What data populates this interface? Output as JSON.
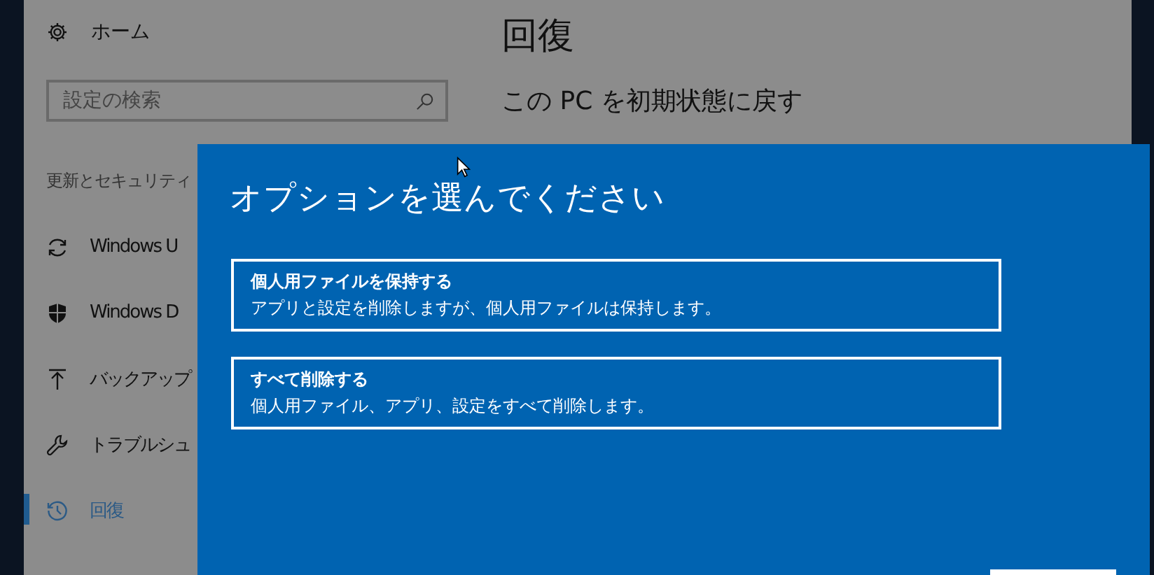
{
  "sidebar": {
    "home": "ホーム",
    "search": {
      "placeholder": "設定の検索"
    },
    "section": "更新とセキュリティ",
    "items": [
      {
        "kind": "sync",
        "label": "Windows U",
        "selected": false
      },
      {
        "kind": "shield",
        "label": "Windows D",
        "selected": false
      },
      {
        "kind": "backup",
        "label": "バックアップ",
        "selected": false
      },
      {
        "kind": "wrench",
        "label": "トラブルシュ",
        "selected": false
      },
      {
        "kind": "history",
        "label": "回復",
        "selected": true
      }
    ]
  },
  "content": {
    "title": "回復",
    "heading": "この PC を初期状態に戻す"
  },
  "dialog": {
    "title": "オプションを選んでください",
    "options": [
      {
        "title": "個人用ファイルを保持する",
        "description": "アプリと設定を削除しますが、個人用ファイルは保持します。"
      },
      {
        "title": "すべて削除する",
        "description": "個人用ファイル、アプリ、設定をすべて削除します。"
      }
    ]
  }
}
